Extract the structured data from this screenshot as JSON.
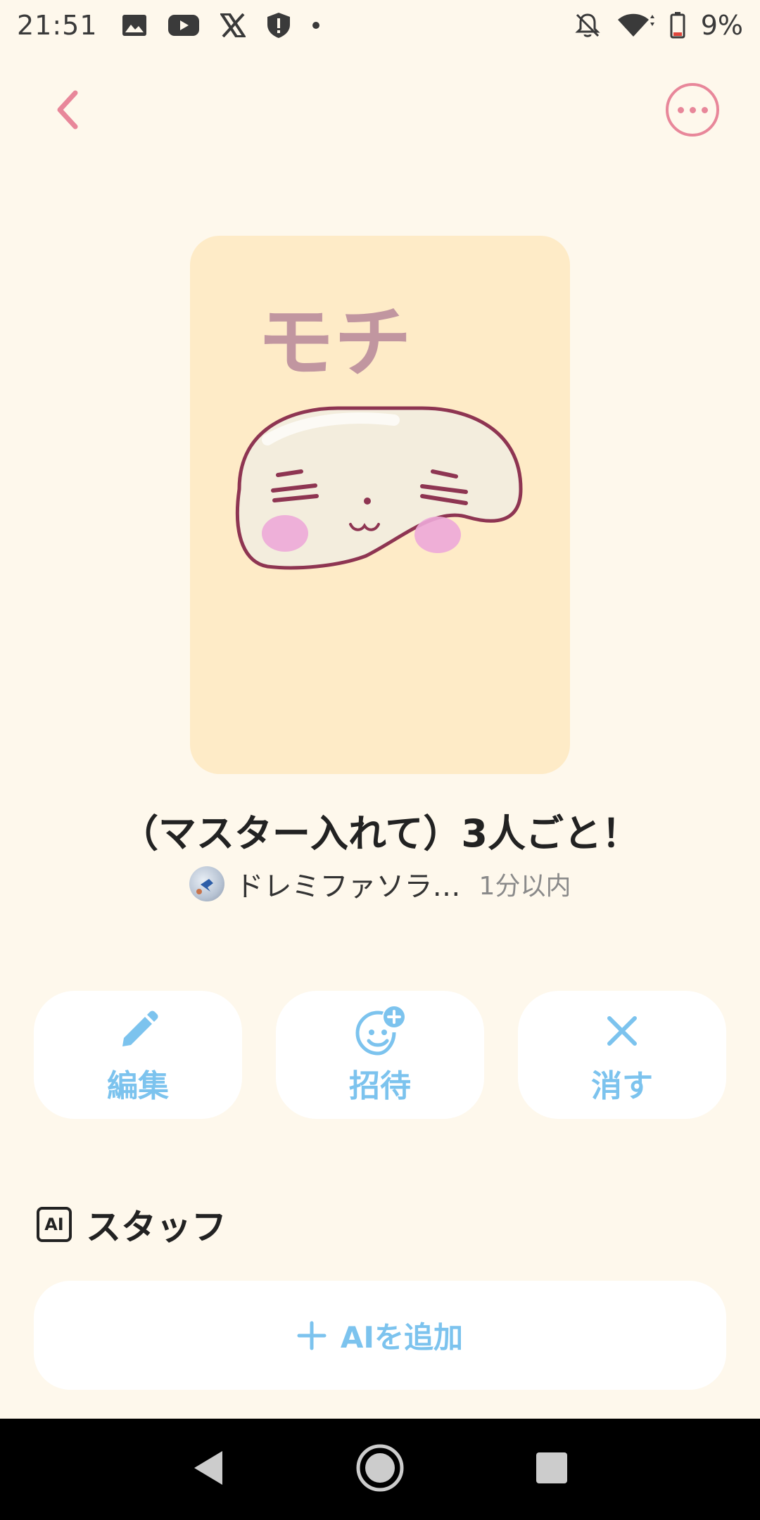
{
  "status_bar": {
    "time": "21:51",
    "battery": "9%",
    "left_icons": [
      "image-icon",
      "youtube-icon",
      "x-icon",
      "shield-icon",
      "dot-icon"
    ],
    "right_icons": [
      "bell-off-icon",
      "wifi-icon",
      "battery-icon"
    ]
  },
  "header": {
    "back_icon": "chevron-left-icon",
    "more_icon": "more-horizontal-icon",
    "accent_color": "#E8879A"
  },
  "story": {
    "cover_text": "モチ",
    "title": "（マスター入れて）3人ごと！",
    "owner_name": "ドレミファソラ…",
    "updated": "1分以内"
  },
  "actions": [
    {
      "icon": "pencil-icon",
      "label": "編集"
    },
    {
      "icon": "invite-icon",
      "label": "招待"
    },
    {
      "icon": "close-icon",
      "label": "消す"
    }
  ],
  "staff": {
    "badge": "AI",
    "title": "スタッフ",
    "add_label": "AIを追加"
  },
  "colors": {
    "background": "#FEF8EC",
    "card": "#FEEBC7",
    "action_blue": "#7CC3EE"
  },
  "nav_bar": [
    "back-triangle-icon",
    "home-circle-icon",
    "recents-square-icon"
  ]
}
